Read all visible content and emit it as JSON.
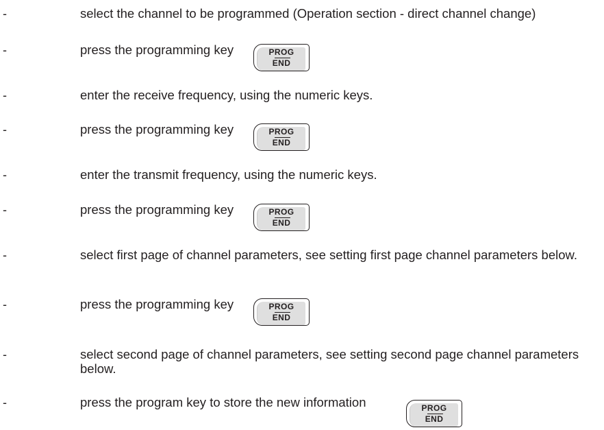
{
  "steps": [
    {
      "bullet": "-",
      "text": "select the channel to be programmed (Operation section - direct channel change)"
    },
    {
      "bullet": "-",
      "text": "press the programming key"
    },
    {
      "bullet": "-",
      "text": "enter the receive frequency, using the numeric keys."
    },
    {
      "bullet": "-",
      "text": "press the programming key"
    },
    {
      "bullet": "-",
      "text": "enter the transmit frequency, using the numeric keys."
    },
    {
      "bullet": "-",
      "text": "press the programming key"
    },
    {
      "bullet": "-",
      "text": "select first page of channel parameters, see setting first page channel parameters below."
    },
    {
      "bullet": "-",
      "text": "press the programming key"
    },
    {
      "bullet": "-",
      "text": "select second page of channel parameters, see setting second page channel parameters below."
    },
    {
      "bullet": "-",
      "text": "press the program key to store the new information"
    }
  ],
  "prog_key": {
    "top_label": "PROG",
    "bottom_label": "END"
  }
}
